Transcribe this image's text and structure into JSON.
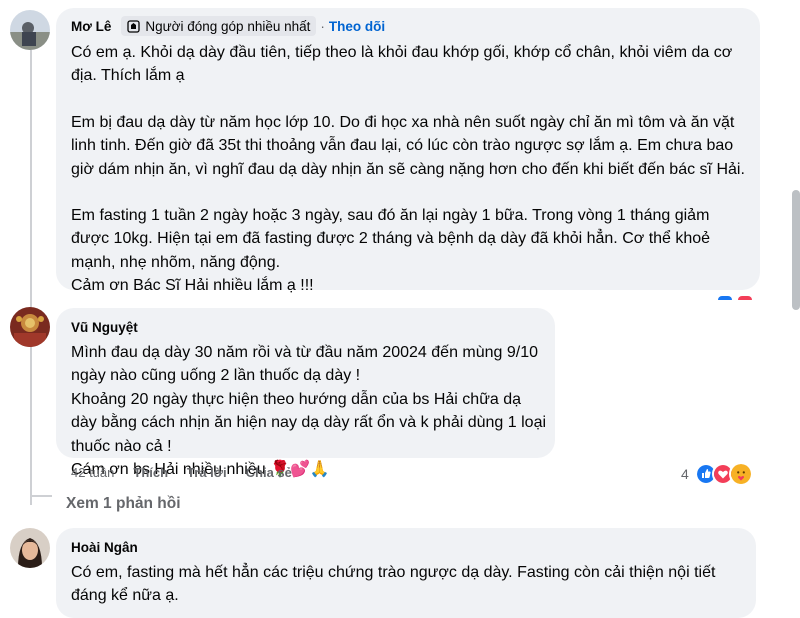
{
  "comment1": {
    "author": "Mơ Lê",
    "badge": "Người đóng góp nhiều nhất",
    "separator": "·",
    "follow": "Theo dõi",
    "paragraphs": [
      "Có em ạ. Khỏi dạ dày đầu tiên, tiếp theo là khỏi đau khớp gối, khớp cổ chân, khỏi viêm da cơ địa. Thích lắm ạ",
      "Em bị đau dạ dày từ năm học lớp 10. Do đi học xa nhà nên suốt ngày chỉ ăn mì tôm và ăn vặt linh tinh. Đến giờ đã 35t thi thoảng vẫn đau lại, có lúc còn trào ngược sợ lắm ạ. Em chưa bao giờ dám nhịn ăn, vì nghĩ đau dạ dày nhịn ăn sẽ càng nặng hơn cho đến khi biết đến bác sĩ Hải.",
      "Em fasting 1 tuần 2 ngày hoặc 3 ngày, sau đó ăn lại ngày 1 bữa. Trong vòng 1 tháng giảm được 10kg. Hiện tại em đã fasting được 2 tháng và bệnh dạ dày đã khỏi hẳn. Cơ thể khoẻ mạnh, nhẹ nhõm, năng động.",
      "Cảm ơn Bác Sĩ Hải nhiều lắm ạ !!!"
    ]
  },
  "comment2": {
    "author": "Vũ Nguyệt",
    "lines": [
      "Mình đau dạ dày 30 năm rồi và từ đầu năm 20024 đến mùng 9/10 ngày nào cũng uống 2 lần thuốc dạ dày !",
      "Khoảng 20 ngày thực hiện theo hướng dẫn của bs Hải chữa dạ dày bằng cách nhịn ăn hiện nay dạ dày rất ổn và k phải dùng 1 loại thuốc nào cả !",
      "Cám ơn bs Hải nhiều nhiều 🌹💕🙏"
    ],
    "time": "42 tuần",
    "like": "Thích",
    "reply": "Trả lời",
    "share": "Chia sẻ",
    "reaction_count": "4"
  },
  "view_replies": "Xem 1 phản hồi",
  "comment3": {
    "author": "Hoài Ngân",
    "paragraphs": [
      "Có em, fasting mà hết hẳn các triệu chứng trào ngược dạ dày. Fasting còn cải thiện nội tiết đáng kể nữa ạ."
    ]
  },
  "colors": {
    "bubble": "#f0f2f5",
    "link": "#0064d1",
    "muted": "#65676b",
    "like": "#1877f2",
    "love": "#f33e58",
    "care": "#f7b125"
  },
  "icons": [
    "contributor-badge-icon",
    "like-reaction-icon",
    "love-reaction-icon",
    "care-reaction-icon"
  ]
}
